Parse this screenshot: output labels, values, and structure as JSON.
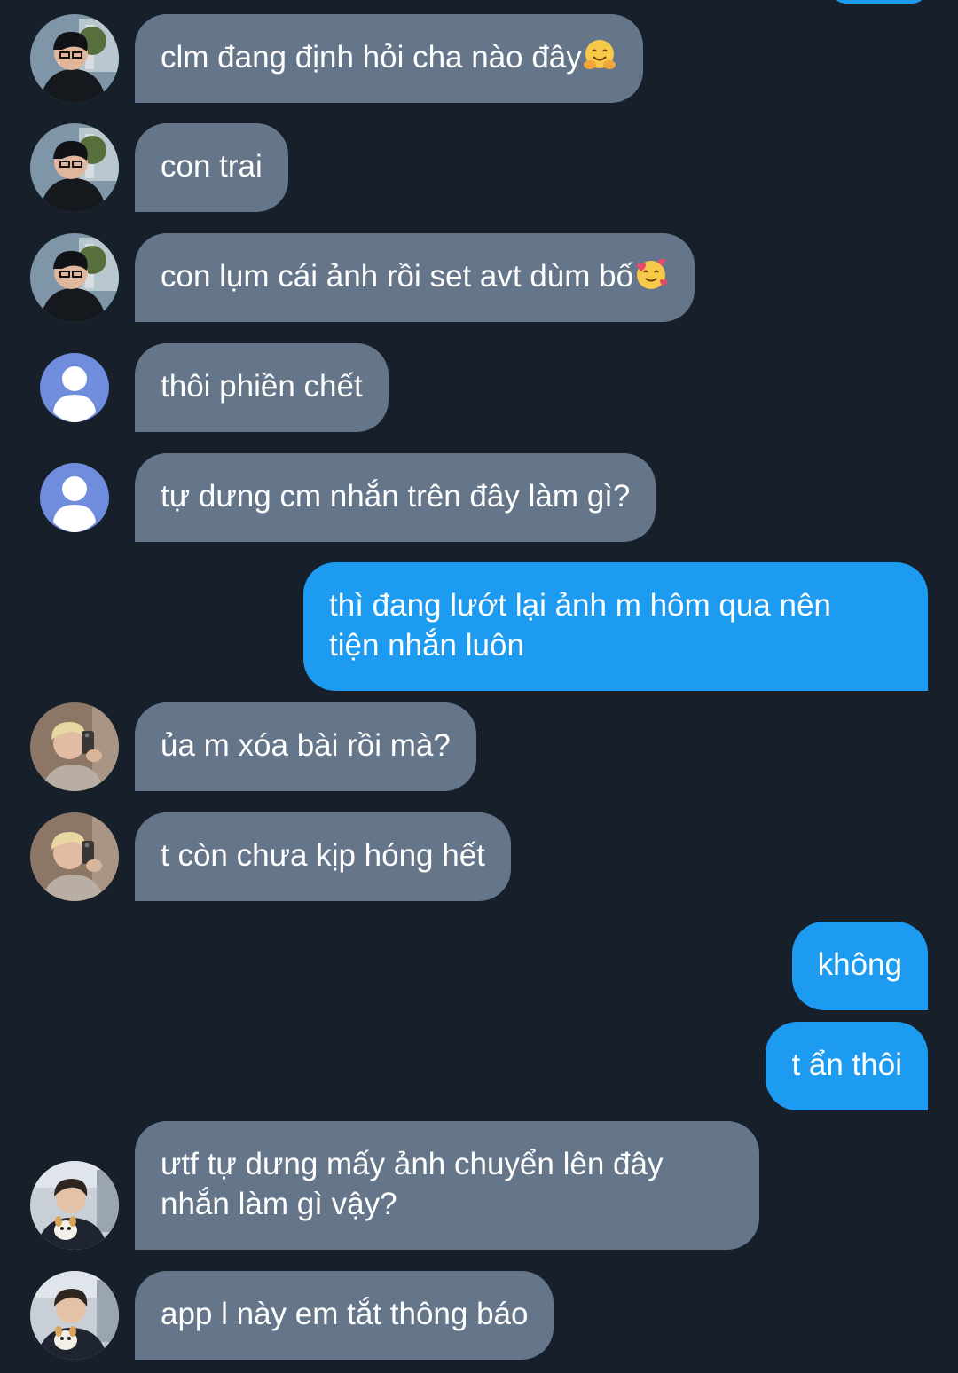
{
  "colors": {
    "background": "#17202a",
    "incoming_bubble": "#65768a",
    "outgoing_bubble": "#1d9bf0",
    "text": "#ffffff"
  },
  "messages": [
    {
      "sender": "incoming",
      "avatar": "dark-hair-man-avatar",
      "text": "clm đang định hỏi cha nào đây",
      "emoji": "hugging-face-emoji"
    },
    {
      "sender": "incoming",
      "avatar": "dark-hair-man-avatar",
      "text": "con trai"
    },
    {
      "sender": "incoming",
      "avatar": "dark-hair-man-avatar",
      "text": "con lụm cái ảnh rồi set avt dùm bố",
      "emoji": "smiling-face-with-hearts-emoji"
    },
    {
      "sender": "incoming",
      "avatar": "default-user-avatar",
      "text": "thôi phiền chết"
    },
    {
      "sender": "incoming",
      "avatar": "default-user-avatar",
      "text": "tự dưng cm nhắn trên đây làm gì?"
    },
    {
      "sender": "outgoing",
      "line1": "thì đang lướt lại ảnh m hôm qua nên",
      "line2": "tiện nhắn luôn"
    },
    {
      "sender": "incoming",
      "avatar": "blonde-man-selfie-avatar",
      "text": "ủa m xóa bài rồi mà?"
    },
    {
      "sender": "incoming",
      "avatar": "blonde-man-selfie-avatar",
      "text": "t còn chưa kịp hóng hết"
    },
    {
      "sender": "outgoing",
      "text": "không"
    },
    {
      "sender": "outgoing",
      "text": "t ẩn thôi"
    },
    {
      "sender": "incoming",
      "avatar": "man-with-pet-avatar",
      "line1": "ưtf tự dưng mấy ảnh chuyển lên đây",
      "line2": "nhắn làm gì vậy?"
    },
    {
      "sender": "incoming",
      "avatar": "man-with-pet-avatar",
      "text": "app l này em tắt thông báo"
    }
  ]
}
